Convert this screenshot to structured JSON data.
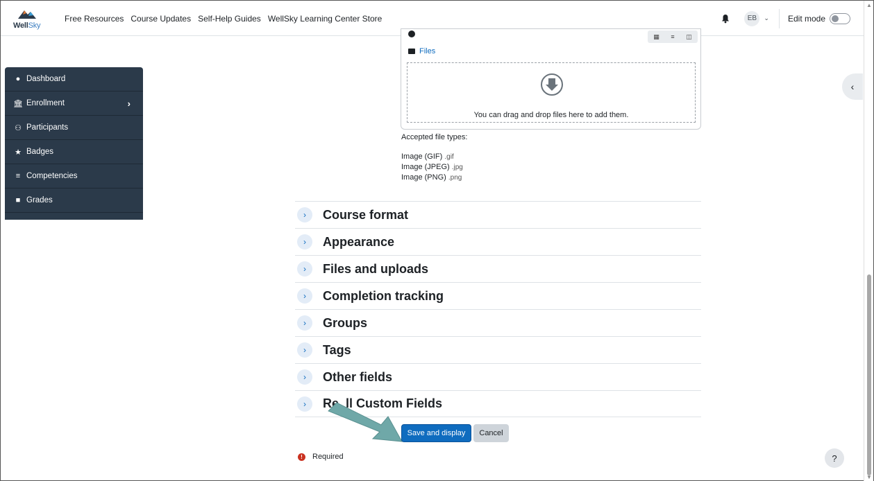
{
  "nav": {
    "logo_text_a": "Well",
    "logo_text_b": "Sky",
    "links": [
      "Free Resources",
      "Course Updates",
      "Self-Help Guides",
      "WellSky Learning Center Store"
    ],
    "avatar_initials": "EB",
    "edit_mode_label": "Edit mode"
  },
  "drawer": {
    "items": [
      {
        "label": "Dashboard",
        "icon": "dashboard-icon"
      },
      {
        "label": "Enrollment",
        "icon": "institution-icon"
      },
      {
        "label": "Participants",
        "icon": "users-icon"
      },
      {
        "label": "Badges",
        "icon": "badge-icon"
      },
      {
        "label": "Competencies",
        "icon": "list-check-icon"
      },
      {
        "label": "Grades",
        "icon": "grades-icon"
      }
    ]
  },
  "filemanager": {
    "path_label": "Files",
    "drop_text": "You can drag and drop files here to add them."
  },
  "accepted_label": "Accepted file types:",
  "file_types": [
    {
      "name": "Image (GIF)",
      "ext": ".gif"
    },
    {
      "name": "Image (JPEG)",
      "ext": ".jpg"
    },
    {
      "name": "Image (PNG)",
      "ext": ".png"
    }
  ],
  "sections": [
    "Course format",
    "Appearance",
    "Files and uploads",
    "Completion tracking",
    "Groups",
    "Tags",
    "Other fields",
    "Re  ll Custom Fields"
  ],
  "buttons": {
    "save": "Save and display",
    "cancel": "Cancel"
  },
  "required_label": "Required",
  "help_label": "?",
  "colors": {
    "primary": "#0f6cbf",
    "drawer_bg": "#2b3a4a",
    "arrow": "#6fa8a8",
    "required": "#ca3120"
  }
}
